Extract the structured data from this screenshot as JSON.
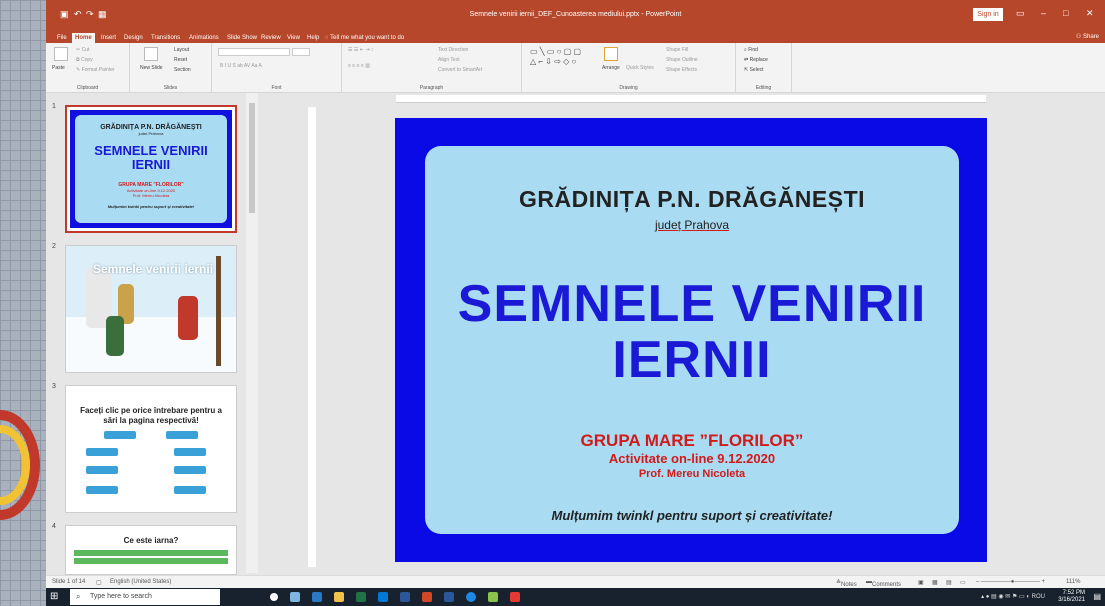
{
  "window": {
    "title": "Semnele venirii iernii_DEF_Cunoasterea mediului.pptx - PowerPoint",
    "signin": "Sign in",
    "share": "Share"
  },
  "tabs": [
    "File",
    "Home",
    "Insert",
    "Design",
    "Transitions",
    "Animations",
    "Slide Show",
    "Review",
    "View",
    "Help",
    "Tell me what you want to do"
  ],
  "ribbon": {
    "clipboard": {
      "paste": "Paste",
      "cut": "Cut",
      "copy": "Copy",
      "format_painter": "Format Painter",
      "label": "Clipboard"
    },
    "slides": {
      "new_slide": "New Slide",
      "layout": "Layout",
      "reset": "Reset",
      "section": "Section",
      "label": "Slides"
    },
    "font": {
      "label": "Font"
    },
    "paragraph": {
      "text_direction": "Text Direction",
      "align_text": "Align Text",
      "convert": "Convert to SmartArt",
      "label": "Paragraph"
    },
    "drawing": {
      "arrange": "Arrange",
      "quick_styles": "Quick Styles",
      "shape_fill": "Shape Fill",
      "shape_outline": "Shape Outline",
      "shape_effects": "Shape Effects",
      "label": "Drawing"
    },
    "editing": {
      "find": "Find",
      "replace": "Replace",
      "select": "Select",
      "label": "Editing"
    }
  },
  "thumbnails": {
    "nums": [
      "1",
      "2",
      "3",
      "4"
    ],
    "t1": {
      "title": "GRĂDINIȚA P.N. DRĂGĂNEȘTI",
      "sub": "județ Prahova",
      "main": "SEMNELE VENIRII IERNII",
      "group": "GRUPA MARE \"FLORILOR\"",
      "act": "Activitate on-line 9.12.2020",
      "prof": "Prof. Mereu Nicoleta",
      "thanks": "Mulțumim twinkl pentru suport și creativitate!"
    },
    "t2": {
      "title": "Semnele venirii iernii"
    },
    "t3": {
      "title": "Faceți clic pe orice întrebare pentru a sări la pagina respectivă!"
    },
    "t4": {
      "title": "Ce este iarna?"
    }
  },
  "slide": {
    "title": "GRĂDINIȚA P.N. DRĂGĂNEȘTI",
    "subtitle": "județ Prahova",
    "main": "SEMNELE VENIRII IERNII",
    "group": "GRUPA MARE ”FLORILOR”",
    "activity": "Activitate on-line 9.12.2020",
    "prof": "Prof. Mereu Nicoleta",
    "thanks": "Mulțumim twinkl pentru suport și creativitate!"
  },
  "status": {
    "slide": "Slide 1 of 14",
    "lang": "English (United States)",
    "notes": "Notes",
    "comments": "Comments",
    "zoom": "111%"
  },
  "taskbar": {
    "search": "Type here to search",
    "time": "7:52 PM",
    "date": "3/16/2021",
    "lang": "ROU"
  },
  "colors": {
    "ppt_red": "#b7472a",
    "slide_blue": "#0a0ae6",
    "card_bg": "#a9dcf2",
    "title_blue": "#1a1ad6",
    "accent_red": "#d21a1a"
  }
}
